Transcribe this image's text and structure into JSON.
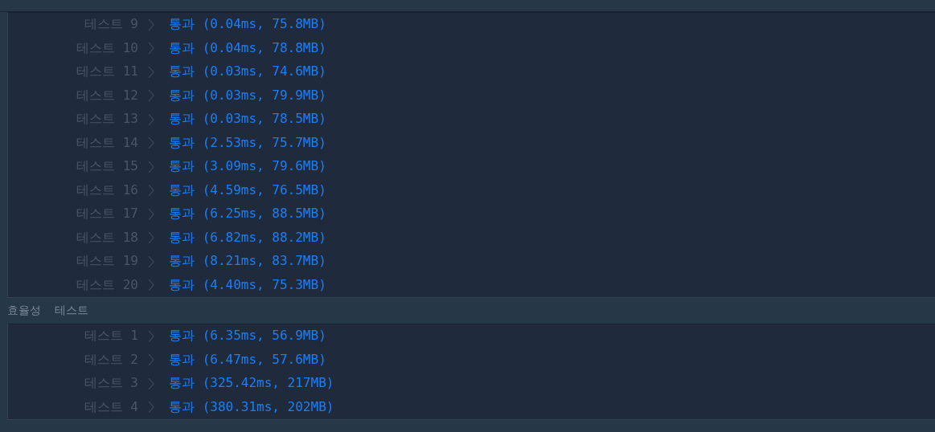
{
  "sections": [
    {
      "rows": [
        {
          "label": "테스트 9",
          "result": "통과 (0.04ms, 75.8MB)"
        },
        {
          "label": "테스트 10",
          "result": "통과 (0.04ms, 78.8MB)"
        },
        {
          "label": "테스트 11",
          "result": "통과 (0.03ms, 74.6MB)"
        },
        {
          "label": "테스트 12",
          "result": "통과 (0.03ms, 79.9MB)"
        },
        {
          "label": "테스트 13",
          "result": "통과 (0.03ms, 78.5MB)"
        },
        {
          "label": "테스트 14",
          "result": "통과 (2.53ms, 75.7MB)"
        },
        {
          "label": "테스트 15",
          "result": "통과 (3.09ms, 79.6MB)"
        },
        {
          "label": "테스트 16",
          "result": "통과 (4.59ms, 76.5MB)"
        },
        {
          "label": "테스트 17",
          "result": "통과 (6.25ms, 88.5MB)"
        },
        {
          "label": "테스트 18",
          "result": "통과 (6.82ms, 88.2MB)"
        },
        {
          "label": "테스트 19",
          "result": "통과 (8.21ms, 83.7MB)"
        },
        {
          "label": "테스트 20",
          "result": "통과 (4.40ms, 75.3MB)"
        }
      ]
    },
    {
      "title": "효율성  테스트",
      "rows": [
        {
          "label": "테스트 1",
          "result": "통과 (6.35ms, 56.9MB)"
        },
        {
          "label": "테스트 2",
          "result": "통과 (6.47ms, 57.6MB)"
        },
        {
          "label": "테스트 3",
          "result": "통과 (325.42ms, 217MB)"
        },
        {
          "label": "테스트 4",
          "result": "통과 (380.31ms, 202MB)"
        }
      ]
    }
  ]
}
